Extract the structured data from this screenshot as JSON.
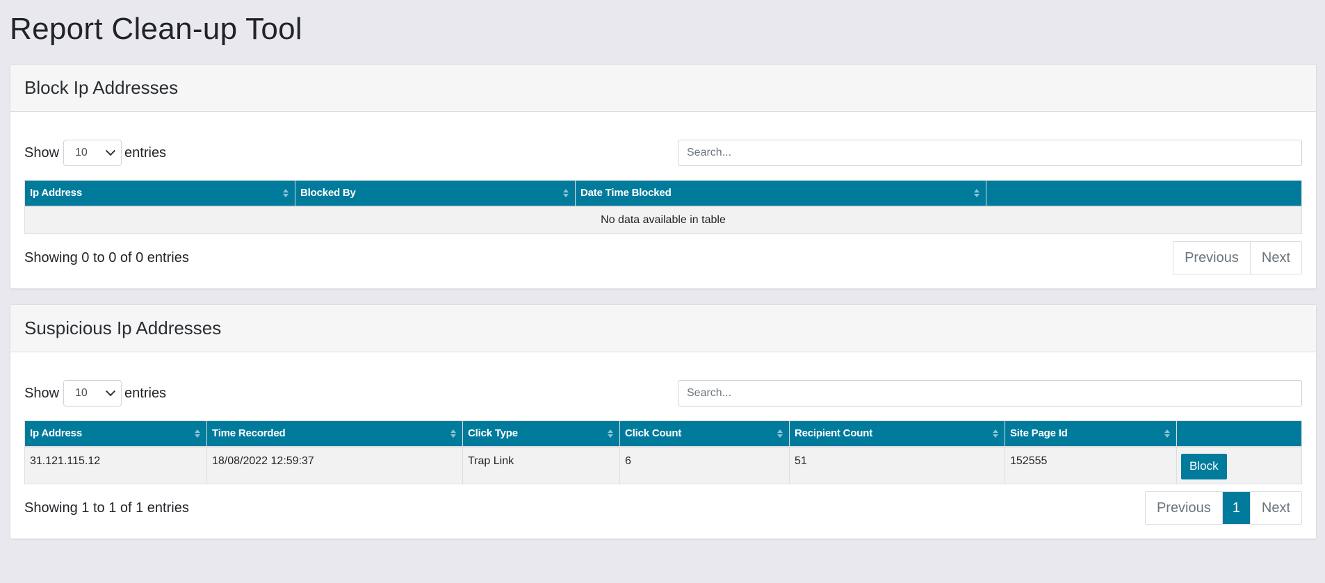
{
  "page": {
    "title": "Report Clean-up Tool"
  },
  "colors": {
    "header_bg": "#007b9c",
    "page_bg": "#e8e8ee",
    "button": "#007b9c"
  },
  "blocked": {
    "title": "Block Ip Addresses",
    "show_label": "Show",
    "entries_label": "entries",
    "page_length": "10",
    "search_placeholder": "Search...",
    "columns": [
      "Ip Address",
      "Blocked By",
      "Date Time Blocked",
      ""
    ],
    "empty_text": "No data available in table",
    "info": "Showing 0 to 0 of 0 entries",
    "prev": "Previous",
    "next": "Next"
  },
  "suspicious": {
    "title": "Suspicious Ip Addresses",
    "show_label": "Show",
    "entries_label": "entries",
    "page_length": "10",
    "search_placeholder": "Search...",
    "columns": [
      "Ip Address",
      "Time Recorded",
      "Click Type",
      "Click Count",
      "Recipient Count",
      "Site Page Id",
      ""
    ],
    "rows": [
      {
        "ip": "31.121.115.12",
        "time": "18/08/2022 12:59:37",
        "click_type": "Trap Link",
        "click_count": "6",
        "recipient_count": "51",
        "site_page_id": "152555",
        "action": "Block"
      }
    ],
    "info": "Showing 1 to 1 of 1 entries",
    "prev": "Previous",
    "current_page": "1",
    "next": "Next"
  }
}
